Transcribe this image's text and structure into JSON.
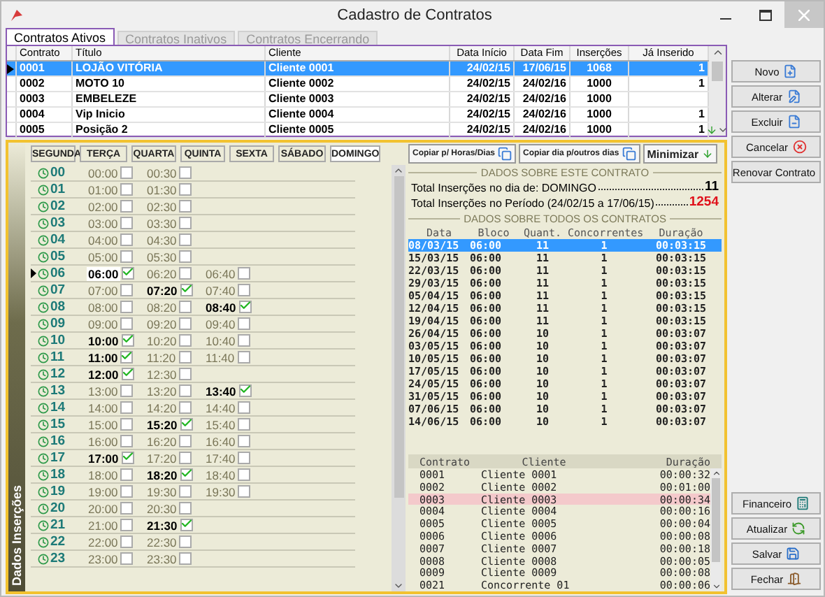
{
  "window": {
    "title": "Cadastro de Contratos"
  },
  "tabs": [
    {
      "label": "Contratos Ativos",
      "selected": true
    },
    {
      "label": "Contratos Inativos",
      "selected": false
    },
    {
      "label": "Contratos Encerrando",
      "selected": false
    }
  ],
  "contracts": {
    "columns": [
      "Contrato",
      "Título",
      "Cliente",
      "Data Início",
      "Data Fim",
      "Inserções",
      "Já Inserido"
    ],
    "rows": [
      {
        "contrato": "0001",
        "titulo": "LOJÃO VITÓRIA",
        "cliente": "Cliente 0001",
        "inicio": "24/02/15",
        "fim": "17/06/15",
        "insercoes": "1068",
        "ja_inserido": "1",
        "selected": true
      },
      {
        "contrato": "0002",
        "titulo": "MOTO 10",
        "cliente": "Cliente 0002",
        "inicio": "24/02/15",
        "fim": "24/02/16",
        "insercoes": "1000",
        "ja_inserido": "1",
        "selected": false
      },
      {
        "contrato": "0003",
        "titulo": "EMBELEZE",
        "cliente": "Cliente 0003",
        "inicio": "24/02/15",
        "fim": "24/02/16",
        "insercoes": "1000",
        "selected": false
      },
      {
        "contrato": "0004",
        "titulo": "Vip Inicio",
        "cliente": "Cliente 0004",
        "inicio": "24/02/15",
        "fim": "24/02/16",
        "insercoes": "1000",
        "ja_inserido": "1",
        "selected": false
      },
      {
        "contrato": "0005",
        "titulo": "Posição 2",
        "cliente": "Cliente 0005",
        "inicio": "24/02/15",
        "fim": "24/02/16",
        "insercoes": "1000",
        "ja_inserido": "1",
        "selected": false
      }
    ]
  },
  "insertions": {
    "side_label": "Dados Inserções",
    "days": [
      {
        "label": "SEGUNDA",
        "selected": false
      },
      {
        "label": "TERÇA",
        "selected": false
      },
      {
        "label": "QUARTA",
        "selected": false
      },
      {
        "label": "QUINTA",
        "selected": false
      },
      {
        "label": "SEXTA",
        "selected": false
      },
      {
        "label": "SÁBADO",
        "selected": false
      },
      {
        "label": "DOMINGO",
        "selected": true
      }
    ],
    "hours": [
      {
        "hour": "00",
        "selected": false,
        "slots": [
          {
            "time": "00:00",
            "checked": false
          },
          {
            "time": "00:30",
            "checked": false
          }
        ]
      },
      {
        "hour": "01",
        "selected": false,
        "slots": [
          {
            "time": "01:00",
            "checked": false
          },
          {
            "time": "01:30",
            "checked": false
          }
        ]
      },
      {
        "hour": "02",
        "selected": false,
        "slots": [
          {
            "time": "02:00",
            "checked": false
          },
          {
            "time": "02:30",
            "checked": false
          }
        ]
      },
      {
        "hour": "03",
        "selected": false,
        "slots": [
          {
            "time": "03:00",
            "checked": false
          },
          {
            "time": "03:30",
            "checked": false
          }
        ]
      },
      {
        "hour": "04",
        "selected": false,
        "slots": [
          {
            "time": "04:00",
            "checked": false
          },
          {
            "time": "04:30",
            "checked": false
          }
        ]
      },
      {
        "hour": "05",
        "selected": false,
        "slots": [
          {
            "time": "05:00",
            "checked": false
          },
          {
            "time": "05:30",
            "checked": false
          }
        ]
      },
      {
        "hour": "06",
        "selected": true,
        "slots": [
          {
            "time": "06:00",
            "checked": true
          },
          {
            "time": "06:20",
            "checked": false
          },
          {
            "time": "06:40",
            "checked": false
          }
        ]
      },
      {
        "hour": "07",
        "selected": false,
        "slots": [
          {
            "time": "07:00",
            "checked": false
          },
          {
            "time": "07:20",
            "checked": true
          },
          {
            "time": "07:40",
            "checked": false
          }
        ]
      },
      {
        "hour": "08",
        "selected": false,
        "slots": [
          {
            "time": "08:00",
            "checked": false
          },
          {
            "time": "08:20",
            "checked": false
          },
          {
            "time": "08:40",
            "checked": true
          }
        ]
      },
      {
        "hour": "09",
        "selected": false,
        "slots": [
          {
            "time": "09:00",
            "checked": false
          },
          {
            "time": "09:20",
            "checked": false
          },
          {
            "time": "09:40",
            "checked": false
          }
        ]
      },
      {
        "hour": "10",
        "selected": false,
        "slots": [
          {
            "time": "10:00",
            "checked": true
          },
          {
            "time": "10:20",
            "checked": false
          },
          {
            "time": "10:40",
            "checked": false
          }
        ]
      },
      {
        "hour": "11",
        "selected": false,
        "slots": [
          {
            "time": "11:00",
            "checked": true
          },
          {
            "time": "11:20",
            "checked": false
          },
          {
            "time": "11:40",
            "checked": false
          }
        ]
      },
      {
        "hour": "12",
        "selected": false,
        "slots": [
          {
            "time": "12:00",
            "checked": true
          },
          {
            "time": "12:30",
            "checked": false
          }
        ]
      },
      {
        "hour": "13",
        "selected": false,
        "slots": [
          {
            "time": "13:00",
            "checked": false
          },
          {
            "time": "13:20",
            "checked": false
          },
          {
            "time": "13:40",
            "checked": true
          }
        ]
      },
      {
        "hour": "14",
        "selected": false,
        "slots": [
          {
            "time": "14:00",
            "checked": false
          },
          {
            "time": "14:20",
            "checked": false
          },
          {
            "time": "14:40",
            "checked": false
          }
        ]
      },
      {
        "hour": "15",
        "selected": false,
        "slots": [
          {
            "time": "15:00",
            "checked": false
          },
          {
            "time": "15:20",
            "checked": true
          },
          {
            "time": "15:40",
            "checked": false
          }
        ]
      },
      {
        "hour": "16",
        "selected": false,
        "slots": [
          {
            "time": "16:00",
            "checked": false
          },
          {
            "time": "16:20",
            "checked": false
          },
          {
            "time": "16:40",
            "checked": false
          }
        ]
      },
      {
        "hour": "17",
        "selected": false,
        "slots": [
          {
            "time": "17:00",
            "checked": true
          },
          {
            "time": "17:20",
            "checked": false
          },
          {
            "time": "17:40",
            "checked": false
          }
        ]
      },
      {
        "hour": "18",
        "selected": false,
        "slots": [
          {
            "time": "18:00",
            "checked": false
          },
          {
            "time": "18:20",
            "checked": true
          },
          {
            "time": "18:40",
            "checked": false
          }
        ]
      },
      {
        "hour": "19",
        "selected": false,
        "slots": [
          {
            "time": "19:00",
            "checked": false
          },
          {
            "time": "19:30",
            "checked": false
          },
          {
            "time": "19:30",
            "checked": false
          }
        ]
      },
      {
        "hour": "20",
        "selected": false,
        "slots": [
          {
            "time": "20:00",
            "checked": false
          },
          {
            "time": "20:30",
            "checked": false
          }
        ]
      },
      {
        "hour": "21",
        "selected": false,
        "slots": [
          {
            "time": "21:00",
            "checked": false
          },
          {
            "time": "21:30",
            "checked": true
          }
        ]
      },
      {
        "hour": "22",
        "selected": false,
        "slots": [
          {
            "time": "22:00",
            "checked": false
          },
          {
            "time": "22:30",
            "checked": false
          }
        ]
      },
      {
        "hour": "23",
        "selected": false,
        "slots": [
          {
            "time": "23:00",
            "checked": false
          },
          {
            "time": "23:30",
            "checked": false
          }
        ]
      }
    ]
  },
  "summary": {
    "buttons": [
      {
        "label": "Copiar p/ Horas/Dias",
        "kind": "copy"
      },
      {
        "label": "Copiar dia p/outros dias",
        "kind": "copy"
      },
      {
        "label": "Minimizar",
        "kind": "minimize"
      }
    ],
    "section_title": "DADOS SOBRE ESTE CONTRATO",
    "lines": [
      {
        "label": "Total Inserções no dia de: DOMINGO",
        "value": "11",
        "kind": "normal"
      },
      {
        "label": "Total Inserções no Período (24/02/15 a 17/06/15)",
        "value": "1254",
        "kind": "alert"
      }
    ]
  },
  "all_contracts": {
    "title": "DADOS SOBRE TODOS OS CONTRATOS",
    "columns": [
      "Data",
      "Bloco",
      "Quant.",
      "Concorrentes",
      "Duração"
    ],
    "rows": [
      {
        "data": "08/03/15",
        "bloco": "06:00",
        "quant": "11",
        "concorrentes": "1",
        "duracao": "00:03:15",
        "selected": true
      },
      {
        "data": "15/03/15",
        "bloco": "06:00",
        "quant": "11",
        "concorrentes": "1",
        "duracao": "00:03:15",
        "selected": false
      },
      {
        "data": "22/03/15",
        "bloco": "06:00",
        "quant": "11",
        "concorrentes": "1",
        "duracao": "00:03:15",
        "selected": false
      },
      {
        "data": "29/03/15",
        "bloco": "06:00",
        "quant": "11",
        "concorrentes": "1",
        "duracao": "00:03:15",
        "selected": false
      },
      {
        "data": "05/04/15",
        "bloco": "06:00",
        "quant": "11",
        "concorrentes": "1",
        "duracao": "00:03:15",
        "selected": false
      },
      {
        "data": "12/04/15",
        "bloco": "06:00",
        "quant": "11",
        "concorrentes": "1",
        "duracao": "00:03:15",
        "selected": false
      },
      {
        "data": "19/04/15",
        "bloco": "06:00",
        "quant": "11",
        "concorrentes": "1",
        "duracao": "00:03:15",
        "selected": false
      },
      {
        "data": "26/04/15",
        "bloco": "06:00",
        "quant": "10",
        "concorrentes": "1",
        "duracao": "00:03:07",
        "selected": false
      },
      {
        "data": "03/05/15",
        "bloco": "06:00",
        "quant": "10",
        "concorrentes": "1",
        "duracao": "00:03:07",
        "selected": false
      },
      {
        "data": "10/05/15",
        "bloco": "06:00",
        "quant": "10",
        "concorrentes": "1",
        "duracao": "00:03:07",
        "selected": false
      },
      {
        "data": "17/05/15",
        "bloco": "06:00",
        "quant": "10",
        "concorrentes": "1",
        "duracao": "00:03:07",
        "selected": false
      },
      {
        "data": "24/05/15",
        "bloco": "06:00",
        "quant": "10",
        "concorrentes": "1",
        "duracao": "00:03:07",
        "selected": false
      },
      {
        "data": "31/05/15",
        "bloco": "06:00",
        "quant": "10",
        "concorrentes": "1",
        "duracao": "00:03:07",
        "selected": false
      },
      {
        "data": "07/06/15",
        "bloco": "06:00",
        "quant": "10",
        "concorrentes": "1",
        "duracao": "00:03:07",
        "selected": false
      },
      {
        "data": "14/06/15",
        "bloco": "06:00",
        "quant": "10",
        "concorrentes": "1",
        "duracao": "00:03:07",
        "selected": false
      }
    ]
  },
  "durations": {
    "columns": [
      "Contrato",
      "Cliente",
      "Duração"
    ],
    "rows": [
      {
        "contrato": "0001",
        "cliente": "Cliente 0001",
        "duracao": "00:00:32",
        "selected": false
      },
      {
        "contrato": "0002",
        "cliente": "Cliente 0002",
        "duracao": "00:01:00",
        "selected": false
      },
      {
        "contrato": "0003",
        "cliente": "Cliente 0003",
        "duracao": "00:00:34",
        "selected": true
      },
      {
        "contrato": "0004",
        "cliente": "Cliente 0004",
        "duracao": "00:00:16",
        "selected": false
      },
      {
        "contrato": "0005",
        "cliente": "Cliente 0005",
        "duracao": "00:00:04",
        "selected": false
      },
      {
        "contrato": "0006",
        "cliente": "Cliente 0006",
        "duracao": "00:00:08",
        "selected": false
      },
      {
        "contrato": "0007",
        "cliente": "Cliente 0007",
        "duracao": "00:00:18",
        "selected": false
      },
      {
        "contrato": "0008",
        "cliente": "Cliente 0008",
        "duracao": "00:00:05",
        "selected": false
      },
      {
        "contrato": "0009",
        "cliente": "Cliente 0009",
        "duracao": "00:00:08",
        "selected": false
      },
      {
        "contrato": "0021",
        "cliente": "Concorrente 01",
        "duracao": "00:00:06",
        "selected": false
      }
    ]
  },
  "actions_top": [
    {
      "label": "Novo",
      "kind": "new"
    },
    {
      "label": "Alterar",
      "kind": "edit"
    },
    {
      "label": "Excluir",
      "kind": "delete"
    },
    {
      "label": "Cancelar",
      "kind": "cancel"
    },
    {
      "label": "Renovar Contrato",
      "kind": "renew"
    }
  ],
  "actions_bottom": [
    {
      "label": "Financeiro",
      "kind": "finance"
    },
    {
      "label": "Atualizar",
      "kind": "refresh"
    },
    {
      "label": "Salvar",
      "kind": "save"
    },
    {
      "label": "Fechar",
      "kind": "close"
    }
  ]
}
